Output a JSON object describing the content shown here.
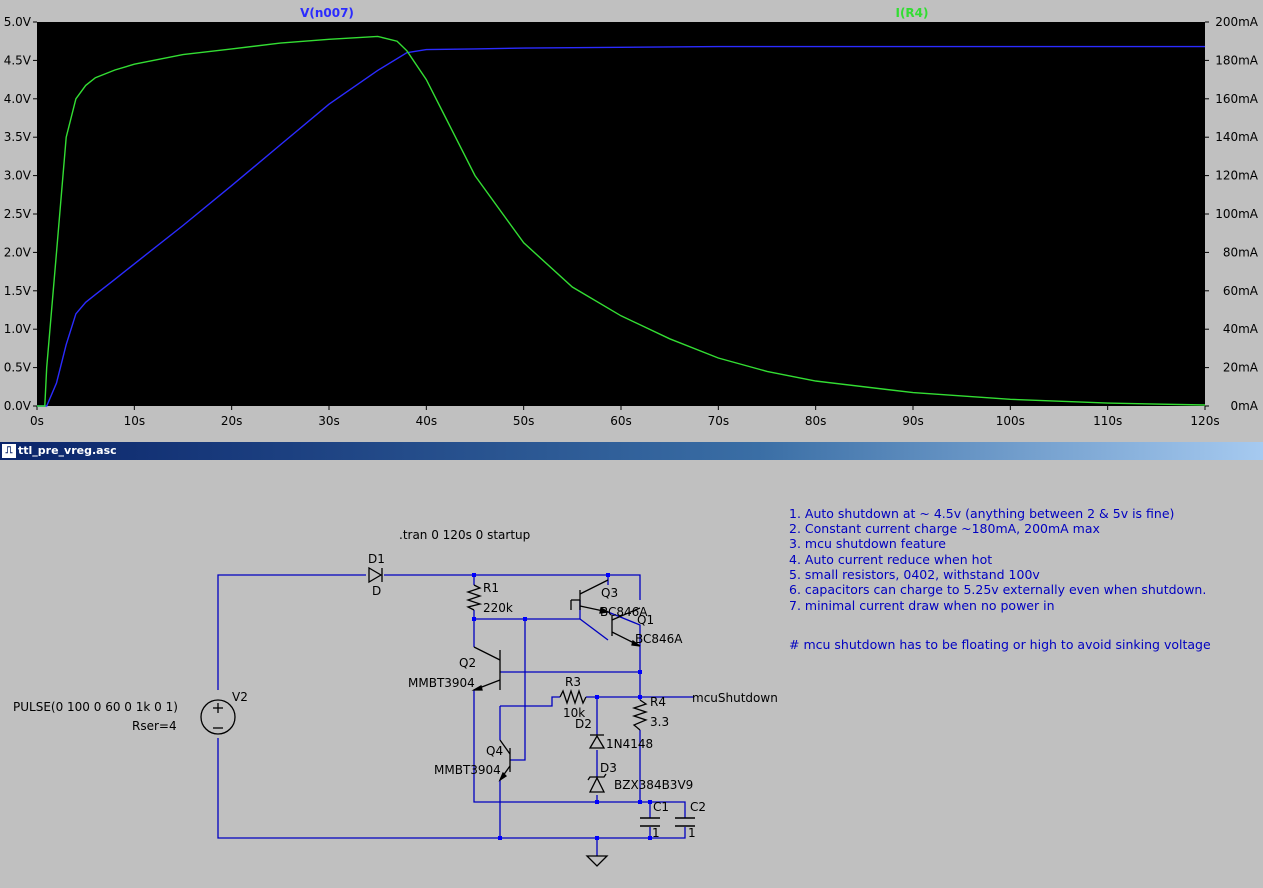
{
  "plot": {
    "left_axis": {
      "ticks": [
        "5.0V",
        "4.5V",
        "4.0V",
        "3.5V",
        "3.0V",
        "2.5V",
        "2.0V",
        "1.5V",
        "1.0V",
        "0.5V",
        "0.0V"
      ]
    },
    "right_axis": {
      "ticks": [
        "200mA",
        "180mA",
        "160mA",
        "140mA",
        "120mA",
        "100mA",
        "80mA",
        "60mA",
        "40mA",
        "20mA",
        "0mA"
      ]
    },
    "x_axis": {
      "ticks": [
        "0s",
        "10s",
        "20s",
        "30s",
        "40s",
        "50s",
        "60s",
        "70s",
        "80s",
        "90s",
        "100s",
        "110s",
        "120s"
      ]
    },
    "colors": {
      "background": "#000000",
      "voltage": "#2b2bff",
      "current": "#33dd33"
    }
  },
  "chart_data": {
    "type": "line",
    "xlabel": "",
    "xlim": [
      0,
      120
    ],
    "ylim_left": [
      0,
      5
    ],
    "ylim_right": [
      0,
      200
    ],
    "series": [
      {
        "name": "V(n007)",
        "axis": "left",
        "color": "#2b2bff",
        "x": [
          0,
          1,
          2,
          3,
          4,
          5,
          6,
          8,
          10,
          15,
          20,
          25,
          30,
          35,
          38,
          40,
          45,
          50,
          60,
          70,
          80,
          90,
          100,
          110,
          120
        ],
        "y": [
          0,
          0,
          0.3,
          0.8,
          1.2,
          1.35,
          1.45,
          1.65,
          1.85,
          2.35,
          2.87,
          3.4,
          3.93,
          4.37,
          4.6,
          4.64,
          4.65,
          4.66,
          4.67,
          4.68,
          4.68,
          4.68,
          4.68,
          4.68,
          4.68
        ]
      },
      {
        "name": "I(R4)",
        "axis": "right",
        "color": "#33dd33",
        "x": [
          0,
          0.8,
          1,
          2,
          3,
          4,
          5,
          6,
          8,
          10,
          15,
          20,
          25,
          30,
          35,
          37,
          38,
          40,
          42,
          45,
          50,
          55,
          60,
          65,
          70,
          75,
          80,
          90,
          100,
          110,
          120
        ],
        "y": [
          0,
          0,
          20,
          80,
          140,
          160,
          167,
          171,
          175,
          178,
          183,
          186,
          189,
          191,
          192.5,
          190,
          185,
          170,
          150,
          120,
          85,
          62,
          47,
          35,
          25,
          18,
          13,
          7,
          3.5,
          1.5,
          0.5
        ]
      }
    ]
  },
  "schematic": {
    "window_title": "ttl_pre_vreg.asc",
    "directive": ".tran 0 120s 0 startup",
    "components": {
      "D1": "D1",
      "D1_val": "D",
      "R1": "R1",
      "R1_val": "220k",
      "Q3": "Q3",
      "Q3_val": "BC846A",
      "Q1": "Q1",
      "Q1_val": "BC846A",
      "Q2": "Q2",
      "Q2_val": "MMBT3904",
      "Q4": "Q4",
      "Q4_val": "MMBT3904",
      "R3": "R3",
      "R3_val": "10k",
      "R4": "R4",
      "R4_val": "3.3",
      "D2": "D2",
      "D2_val": "1N4148",
      "D3": "D3",
      "D3_val": "BZX384B3V9",
      "C1": "C1",
      "C1_val": "1",
      "C2": "C2",
      "C2_val": "1",
      "V2": "V2",
      "V2_pulse": "PULSE(0 100 0 60 0 1k 0 1)",
      "V2_rser": "Rser=4"
    },
    "net_label": "mcuShutdown",
    "notes": [
      "1. Auto shutdown at ~ 4.5v (anything between 2 & 5v is fine)",
      "2. Constant current charge ~180mA, 200mA max",
      "3. mcu shutdown feature",
      "4. Auto current reduce when hot",
      "5. small resistors, 0402, withstand 100v",
      "6. capacitors can charge to 5.25v externally even when shutdown.",
      "7. minimal current draw when no power in"
    ],
    "comment": "# mcu shutdown has to be floating or high to avoid sinking voltage"
  }
}
